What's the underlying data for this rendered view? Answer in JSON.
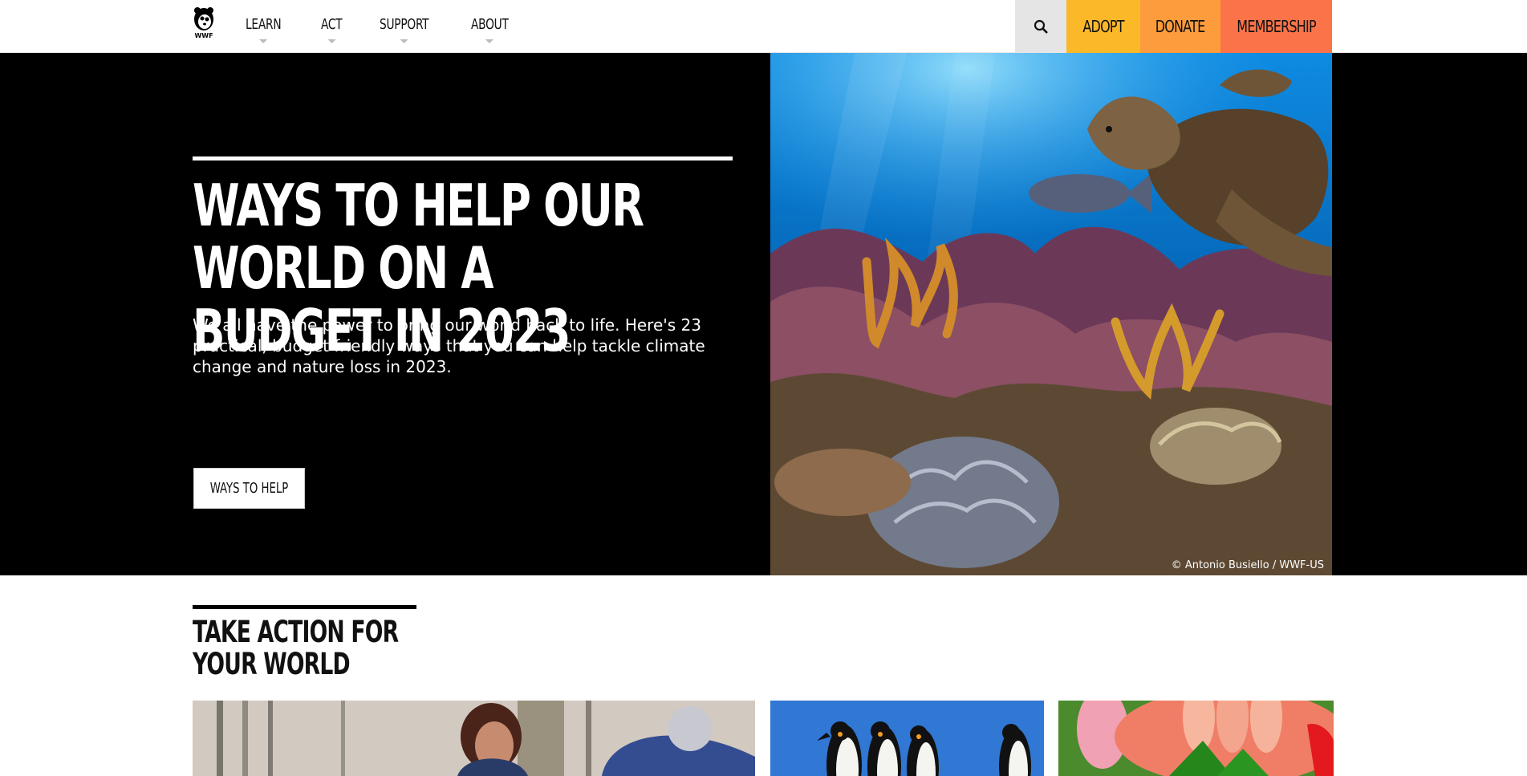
{
  "brand": {
    "logo_text": "WWF"
  },
  "nav": {
    "items": [
      "LEARN",
      "ACT",
      "SUPPORT",
      "ABOUT"
    ]
  },
  "actions": {
    "search_icon": "search-icon",
    "adopt": "ADOPT",
    "donate": "DONATE",
    "membership": "MEMBERSHIP"
  },
  "hero": {
    "title": "WAYS TO HELP OUR WORLD ON A BUDGET IN 2023",
    "description": "We all have the power to bring our world back to life. Here's 23 practical, budget friendly ways that you can help tackle climate change and nature loss in 2023.",
    "button_label": "WAYS TO HELP",
    "photo_credit": "© Antonio Busiello / WWF-US"
  },
  "section": {
    "title": "TAKE ACTION FOR YOUR WORLD"
  },
  "colors": {
    "adopt": "#fbb829",
    "donate": "#fd9c3d",
    "membership": "#fb7449",
    "hero_background": "#000000"
  }
}
